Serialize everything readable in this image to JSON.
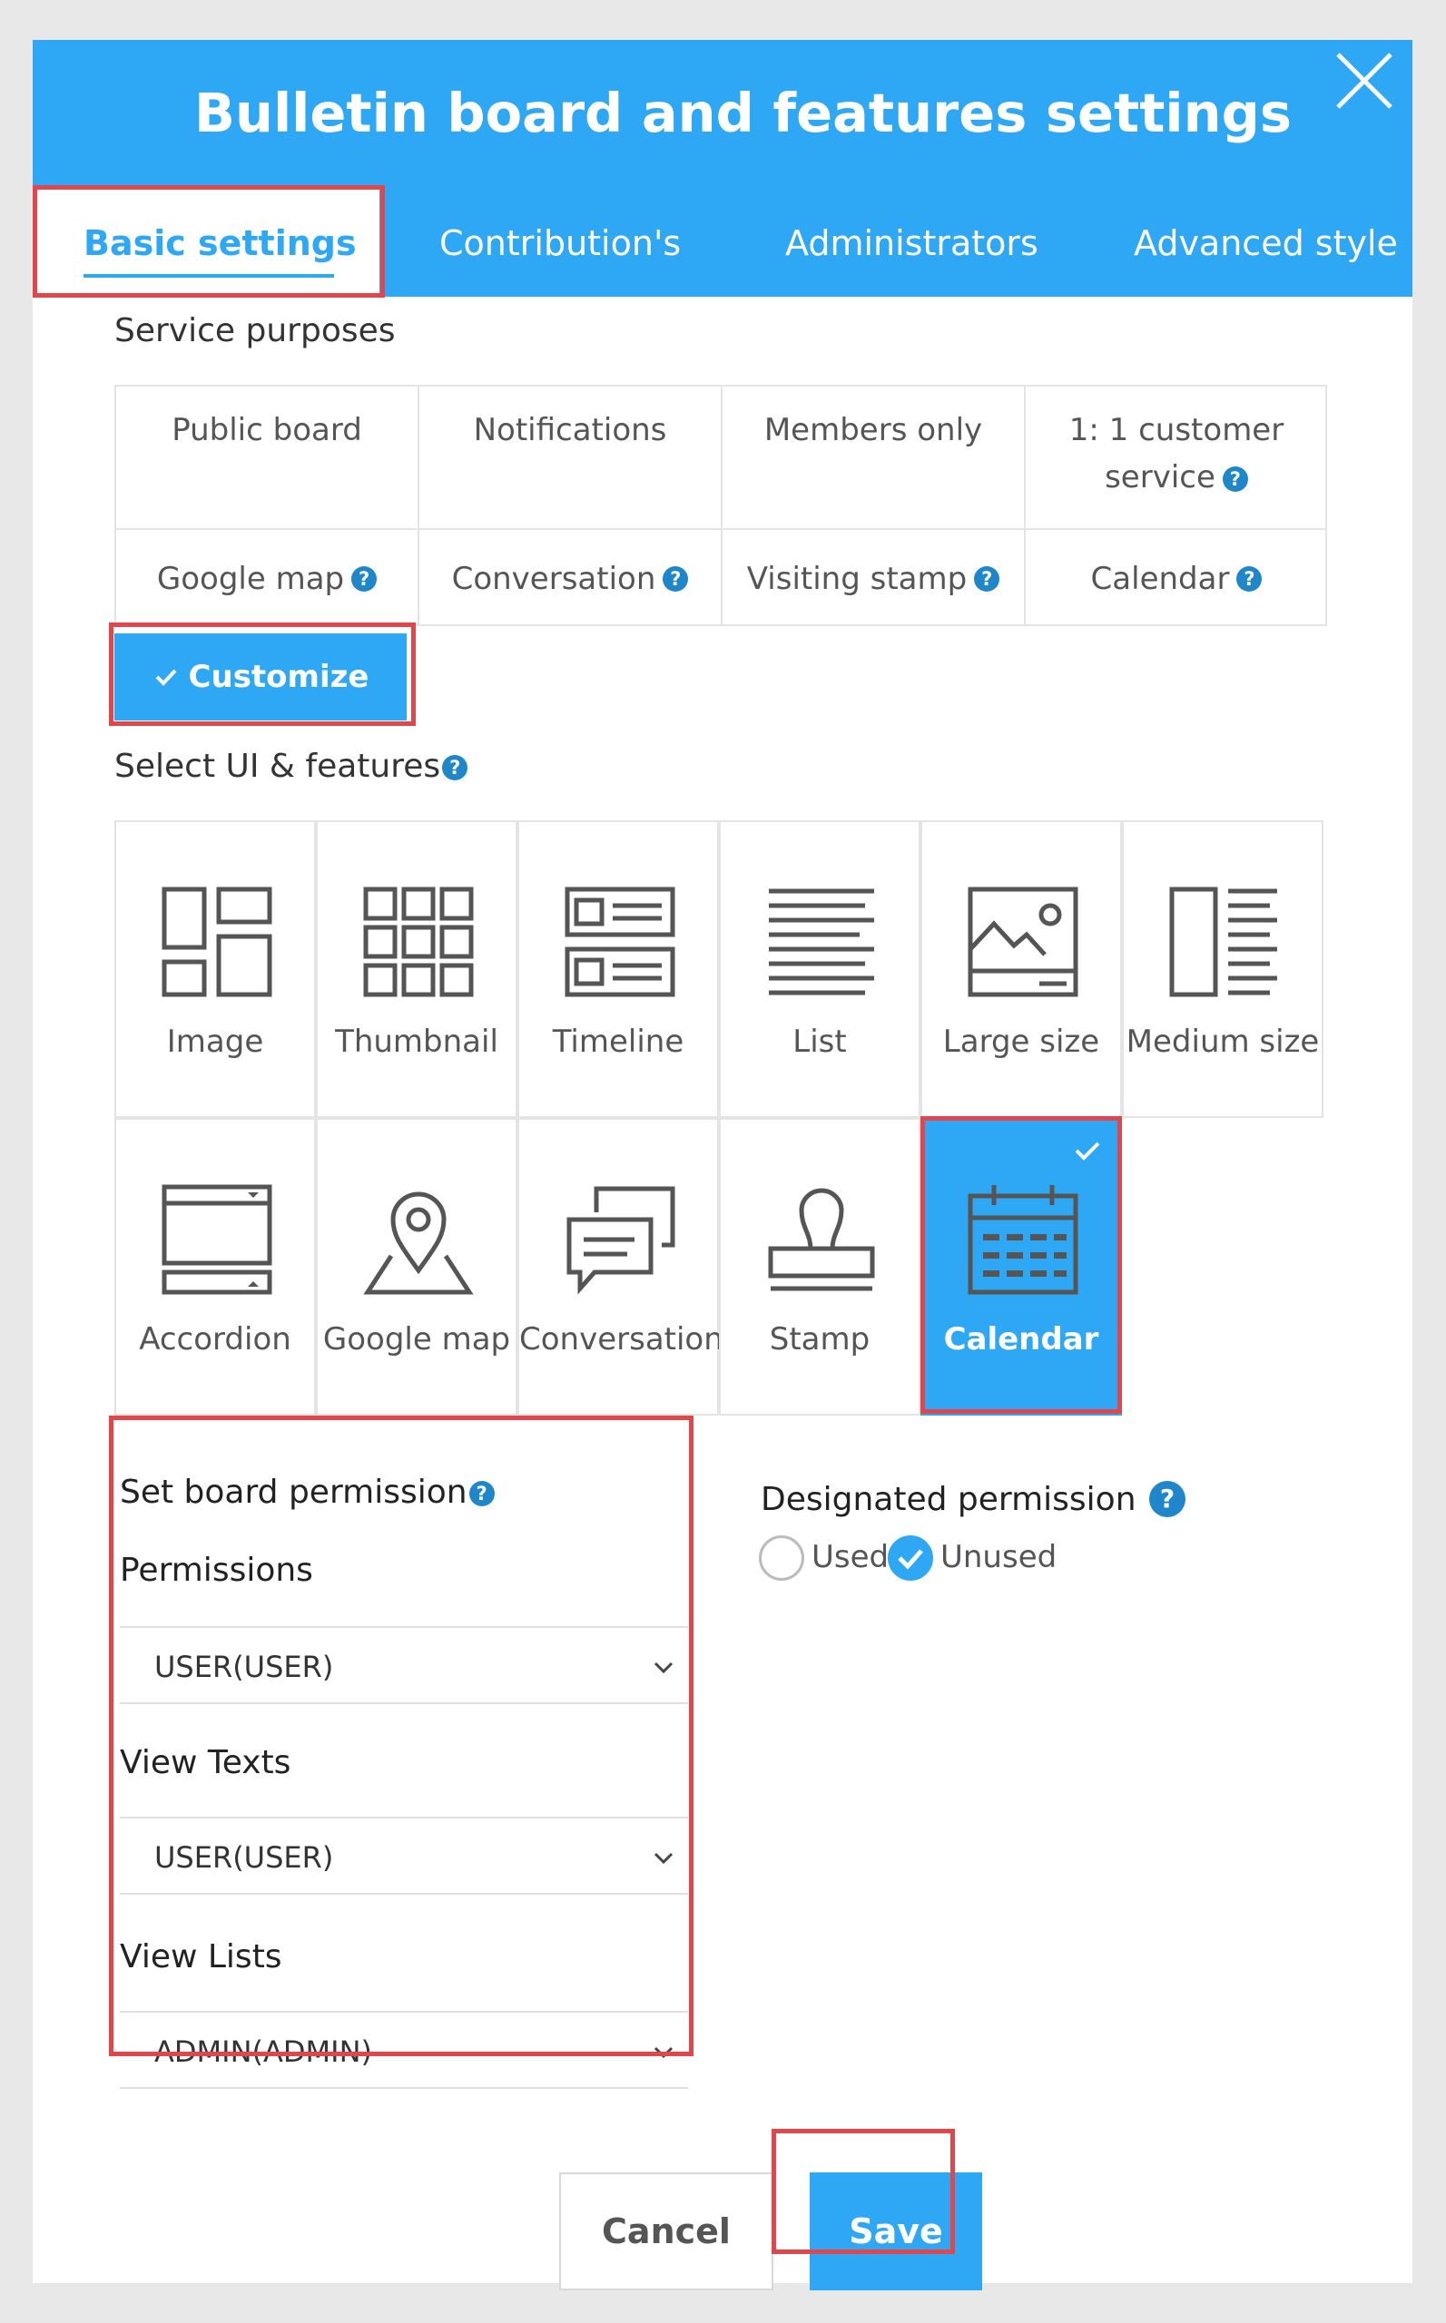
{
  "modal": {
    "title": "Bulletin board and features settings"
  },
  "tabs": [
    {
      "label": "Basic settings",
      "active": true
    },
    {
      "label": "Contribution's",
      "active": false
    },
    {
      "label": "Administrators",
      "active": false
    },
    {
      "label": "Advanced style",
      "active": false
    }
  ],
  "service": {
    "label": "Service purposes",
    "items": [
      {
        "label": "Public board",
        "help": false
      },
      {
        "label": "Notifications",
        "help": false
      },
      {
        "label": "Members only",
        "help": false
      },
      {
        "label": "1: 1 customer",
        "label2": "service",
        "help": true
      },
      {
        "label": "Google map",
        "help": true
      },
      {
        "label": "Conversation",
        "help": true
      },
      {
        "label": "Visiting stamp",
        "help": true
      },
      {
        "label": "Calendar",
        "help": true
      }
    ],
    "customize_label": "Customize"
  },
  "ui": {
    "label": "Select UI & features",
    "items": [
      {
        "label": "Image",
        "icon": "image-layout-icon"
      },
      {
        "label": "Thumbnail",
        "icon": "thumbnail-grid-icon"
      },
      {
        "label": "Timeline",
        "icon": "timeline-icon"
      },
      {
        "label": "List",
        "icon": "list-icon"
      },
      {
        "label": "Large size",
        "icon": "large-image-icon"
      },
      {
        "label": "Medium size",
        "icon": "medium-size-icon"
      },
      {
        "label": "Accordion",
        "icon": "accordion-icon"
      },
      {
        "label": "Google map",
        "icon": "map-pin-icon"
      },
      {
        "label": "Conversation",
        "icon": "chat-bubbles-icon"
      },
      {
        "label": "Stamp",
        "icon": "stamp-icon"
      },
      {
        "label": "Calendar",
        "icon": "calendar-icon",
        "selected": true
      }
    ]
  },
  "permission": {
    "title": "Set board permission",
    "fields": [
      {
        "label": "Permissions",
        "value": "USER(USER)"
      },
      {
        "label": "View Texts",
        "value": "USER(USER)"
      },
      {
        "label": "View Lists",
        "value": "ADMIN(ADMIN)"
      }
    ]
  },
  "designated": {
    "title": "Designated permission",
    "options": [
      {
        "label": "Used",
        "checked": false
      },
      {
        "label": "Unused",
        "checked": true
      }
    ]
  },
  "buttons": {
    "cancel": "Cancel",
    "save": "Save"
  },
  "colors": {
    "primary": "#2ea7f4",
    "highlight": "#e0474c",
    "help": "#1e86c9"
  }
}
